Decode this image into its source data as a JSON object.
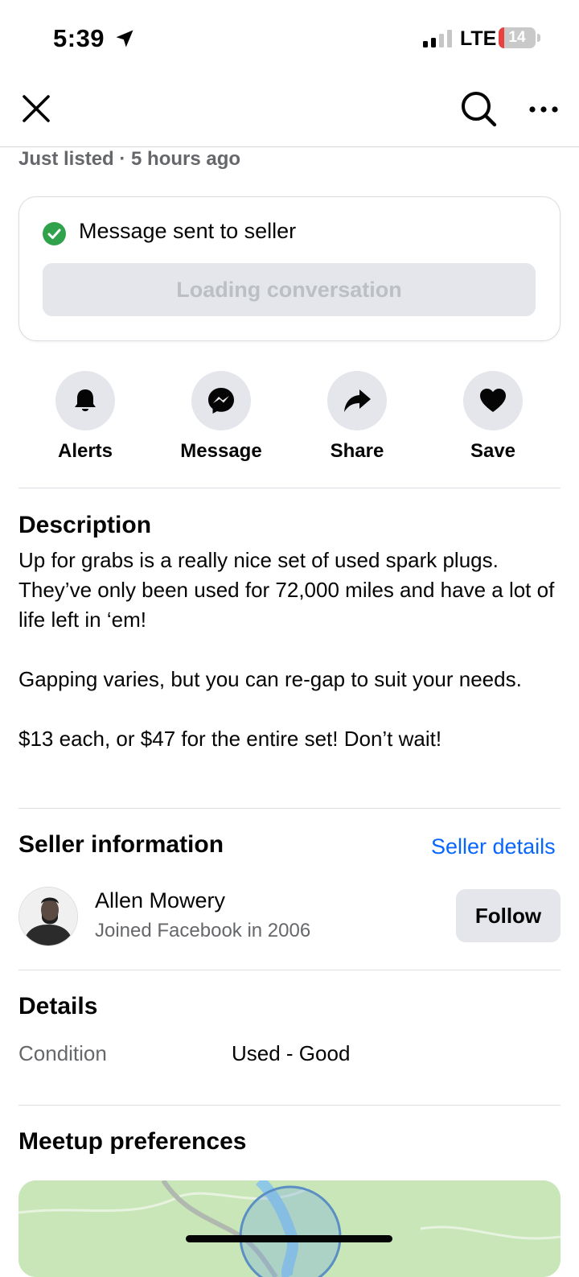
{
  "status_bar": {
    "time": "5:39",
    "network": "LTE",
    "battery": "14",
    "icons": [
      "location-arrow-icon",
      "signal-bars-icon",
      "battery-icon"
    ]
  },
  "nav": {
    "icons": [
      "close-icon",
      "search-icon",
      "more-icon"
    ]
  },
  "listing": {
    "listed_text": "Just listed · 5 hours ago"
  },
  "message_card": {
    "status_text": "Message sent to seller",
    "loading_label": "Loading conversation",
    "accent_color": "#31a24c"
  },
  "actions": [
    {
      "label": "Alerts",
      "icon": "bell-icon"
    },
    {
      "label": "Message",
      "icon": "messenger-icon"
    },
    {
      "label": "Share",
      "icon": "share-icon"
    },
    {
      "label": "Save",
      "icon": "heart-icon"
    }
  ],
  "description": {
    "heading": "Description",
    "body": "Up for grabs is a really nice set of used spark plugs. They’ve only been used for 72,000 miles and have a lot of life left in ‘em!\n\nGapping varies, but you can re-gap to suit your needs.\n\n$13 each, or $47 for the entire set!  Don’t wait!"
  },
  "seller": {
    "heading": "Seller information",
    "details_link": "Seller details",
    "name": "Allen Mowery",
    "joined": "Joined Facebook in 2006",
    "follow_label": "Follow",
    "link_color": "#0866ff"
  },
  "details": {
    "heading": "Details",
    "condition_label": "Condition",
    "condition_value": "Used - Good"
  },
  "meetup": {
    "heading": "Meetup preferences"
  }
}
